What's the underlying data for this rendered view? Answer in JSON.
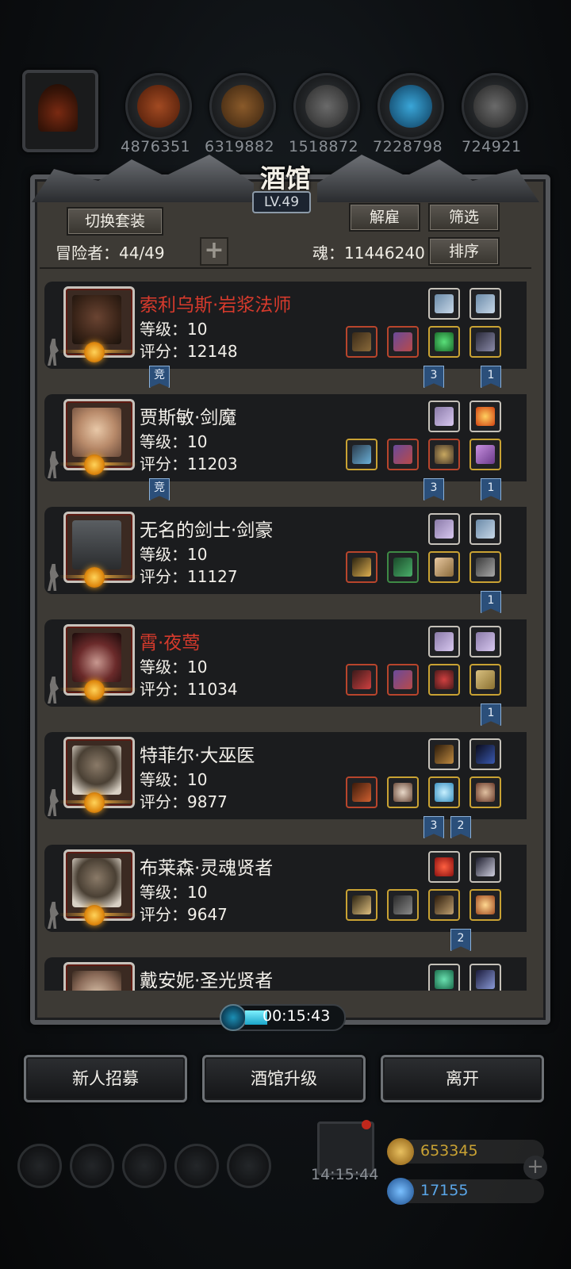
{
  "top_resources": [
    "4876351",
    "6319882",
    "1518872",
    "7228798",
    "724921"
  ],
  "header": {
    "title": "酒馆",
    "level": "LV.49",
    "switch_outfit": "切换套装",
    "dismiss": "解雇",
    "filter": "筛选",
    "sort": "排序",
    "adventurers": "冒险者：44/49",
    "soul": "魂：11446240"
  },
  "heroes": [
    {
      "name": "索利乌斯·岩浆法师",
      "name_color": "red",
      "level": "等级：10",
      "score": "评分：12148"
    },
    {
      "name": "贾斯敏·剑魔",
      "name_color": "white",
      "level": "等级：10",
      "score": "评分：11203"
    },
    {
      "name": "无名的剑士·剑豪",
      "name_color": "white",
      "level": "等级：10",
      "score": "评分：11127"
    },
    {
      "name": "霄·夜莺",
      "name_color": "red",
      "level": "等级：10",
      "score": "评分：11034"
    },
    {
      "name": "特菲尔·大巫医",
      "name_color": "white",
      "level": "等级：10",
      "score": "评分：9877"
    },
    {
      "name": "布莱森·灵魂贤者",
      "name_color": "white",
      "level": "等级：10",
      "score": "评分：9647"
    },
    {
      "name": "戴安妮·圣光贤者",
      "name_color": "white",
      "level": "",
      "score": ""
    }
  ],
  "tags": {
    "compete": "竞",
    "three": "3",
    "two": "2",
    "one": "1"
  },
  "timer": "00:15:43",
  "buttons": {
    "recruit": "新人招募",
    "upgrade": "酒馆升级",
    "leave": "离开"
  },
  "hud": {
    "clock": "14:15:44",
    "gold": "653345",
    "gems": "17155"
  },
  "colors": {
    "red_name": "#d63a2c",
    "panel": "#3d3a35",
    "row": "#1b1c1e",
    "gold_text": "#c9a233",
    "gem_text": "#5aa6e8"
  }
}
